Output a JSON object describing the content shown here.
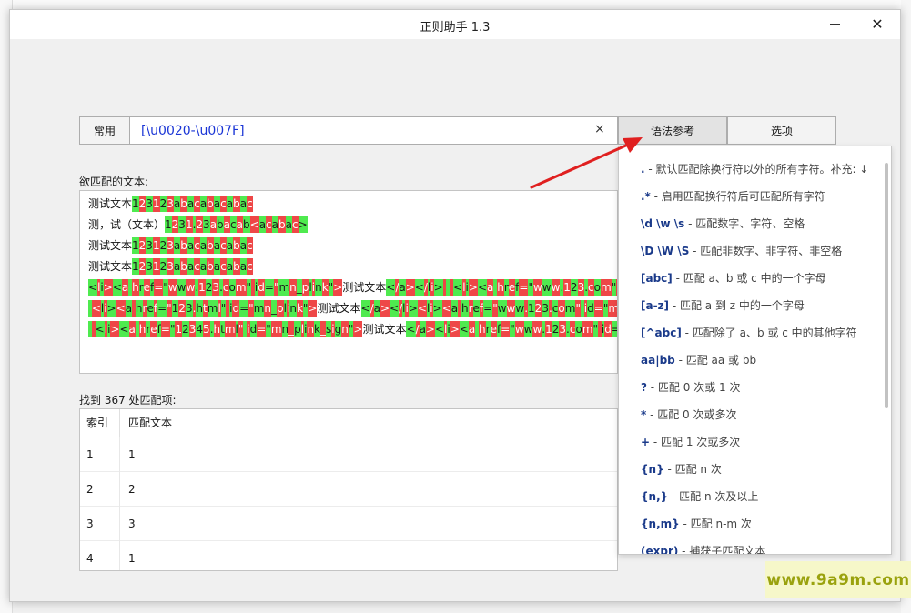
{
  "window": {
    "title": "正则助手 1.3",
    "close_glyph": "✕"
  },
  "toolbar": {
    "common_label": "常用",
    "regex_value": "[\\u0020-\\u007F]",
    "clear_glyph": "×",
    "syntax_label": "语法参考",
    "options_label": "选项"
  },
  "text_label": "欲匹配的文本:",
  "text_lines": [
    [
      {
        "t": "测试文本",
        "c": "plain"
      },
      {
        "t": "123123abacabacabac",
        "c": "alt"
      }
    ],
    [
      {
        "t": "测，试（文本）",
        "c": "plain"
      },
      {
        "t": "1231.23abacab<acabac>",
        "c": "alt"
      }
    ],
    [
      {
        "t": "测试文本",
        "c": "plain"
      },
      {
        "t": "123123abacabacabac",
        "c": "alt"
      }
    ],
    [
      {
        "t": "测试文本",
        "c": "plain"
      },
      {
        "t": "123123abacabacabac",
        "c": "alt"
      }
    ],
    [
      {
        "t": "<li><a href=\"www.123.com\" id=\"mn_plink\">",
        "c": "alt"
      },
      {
        "t": "测试文本",
        "c": "plain"
      },
      {
        "t": "</a></li>   <li><a href=\"www.123.com\" id=\"m",
        "c": "alt"
      }
    ],
    [
      {
        "t": " <li><a href=\"123.html\" id=\"mn_plink\">",
        "c": "alt"
      },
      {
        "t": "测试文本",
        "c": "plain"
      },
      {
        "t": "</a></li><li><a href=\"www.123.com\" id=\"mn_plink",
        "c": "alt"
      }
    ],
    [
      {
        "t": "  <li><a href=\"12345.html\" id=\"mn_plink_sign\">",
        "c": "alt"
      },
      {
        "t": "测试文本",
        "c": "plain"
      },
      {
        "t": "</a><li><a href=\"www.123.com\" id=\"mn_plink\"",
        "c": "alt"
      }
    ]
  ],
  "results": {
    "summary": "找到 367 处匹配项:",
    "col_index": "索引",
    "col_text": "匹配文本",
    "rows": [
      {
        "index": "1",
        "text": "1"
      },
      {
        "index": "2",
        "text": "2"
      },
      {
        "index": "3",
        "text": "3"
      },
      {
        "index": "4",
        "text": "1"
      }
    ]
  },
  "syntax_items": [
    {
      "k": ".",
      "d": " - 默认匹配除换行符以外的所有字符。补充: ↓"
    },
    {
      "k": ".*",
      "d": " - 启用匹配换行符后可匹配所有字符"
    },
    {
      "k": "\\d  \\w  \\s",
      "d": " - 匹配数字、字符、空格"
    },
    {
      "k": "\\D  \\W  \\S",
      "d": " - 匹配非数字、非字符、非空格"
    },
    {
      "k": "[abc]",
      "d": " - 匹配 a、b 或 c 中的一个字母"
    },
    {
      "k": "[a-z]",
      "d": " - 匹配 a 到 z 中的一个字母"
    },
    {
      "k": "[^abc]",
      "d": " - 匹配除了 a、b 或 c 中的其他字符"
    },
    {
      "k": "aa|bb",
      "d": " - 匹配 aa 或 bb"
    },
    {
      "k": "?",
      "d": " - 匹配 0 次或 1 次"
    },
    {
      "k": "*",
      "d": " - 匹配 0 次或多次"
    },
    {
      "k": "+",
      "d": " - 匹配 1 次或多次"
    },
    {
      "k": "{n}",
      "d": " - 匹配 n 次"
    },
    {
      "k": "{n,}",
      "d": " - 匹配 n 次及以上"
    },
    {
      "k": "{n,m}",
      "d": " - 匹配 n-m 次"
    },
    {
      "k": "(expr)",
      "d": " - 捕获子匹配文本"
    }
  ],
  "watermark": "www.9a9m.com",
  "colors": {
    "match_green": "#4fea4f",
    "match_red": "#ee4747",
    "regex_blue": "#1a35d6",
    "arrow_red": "#e02020"
  }
}
